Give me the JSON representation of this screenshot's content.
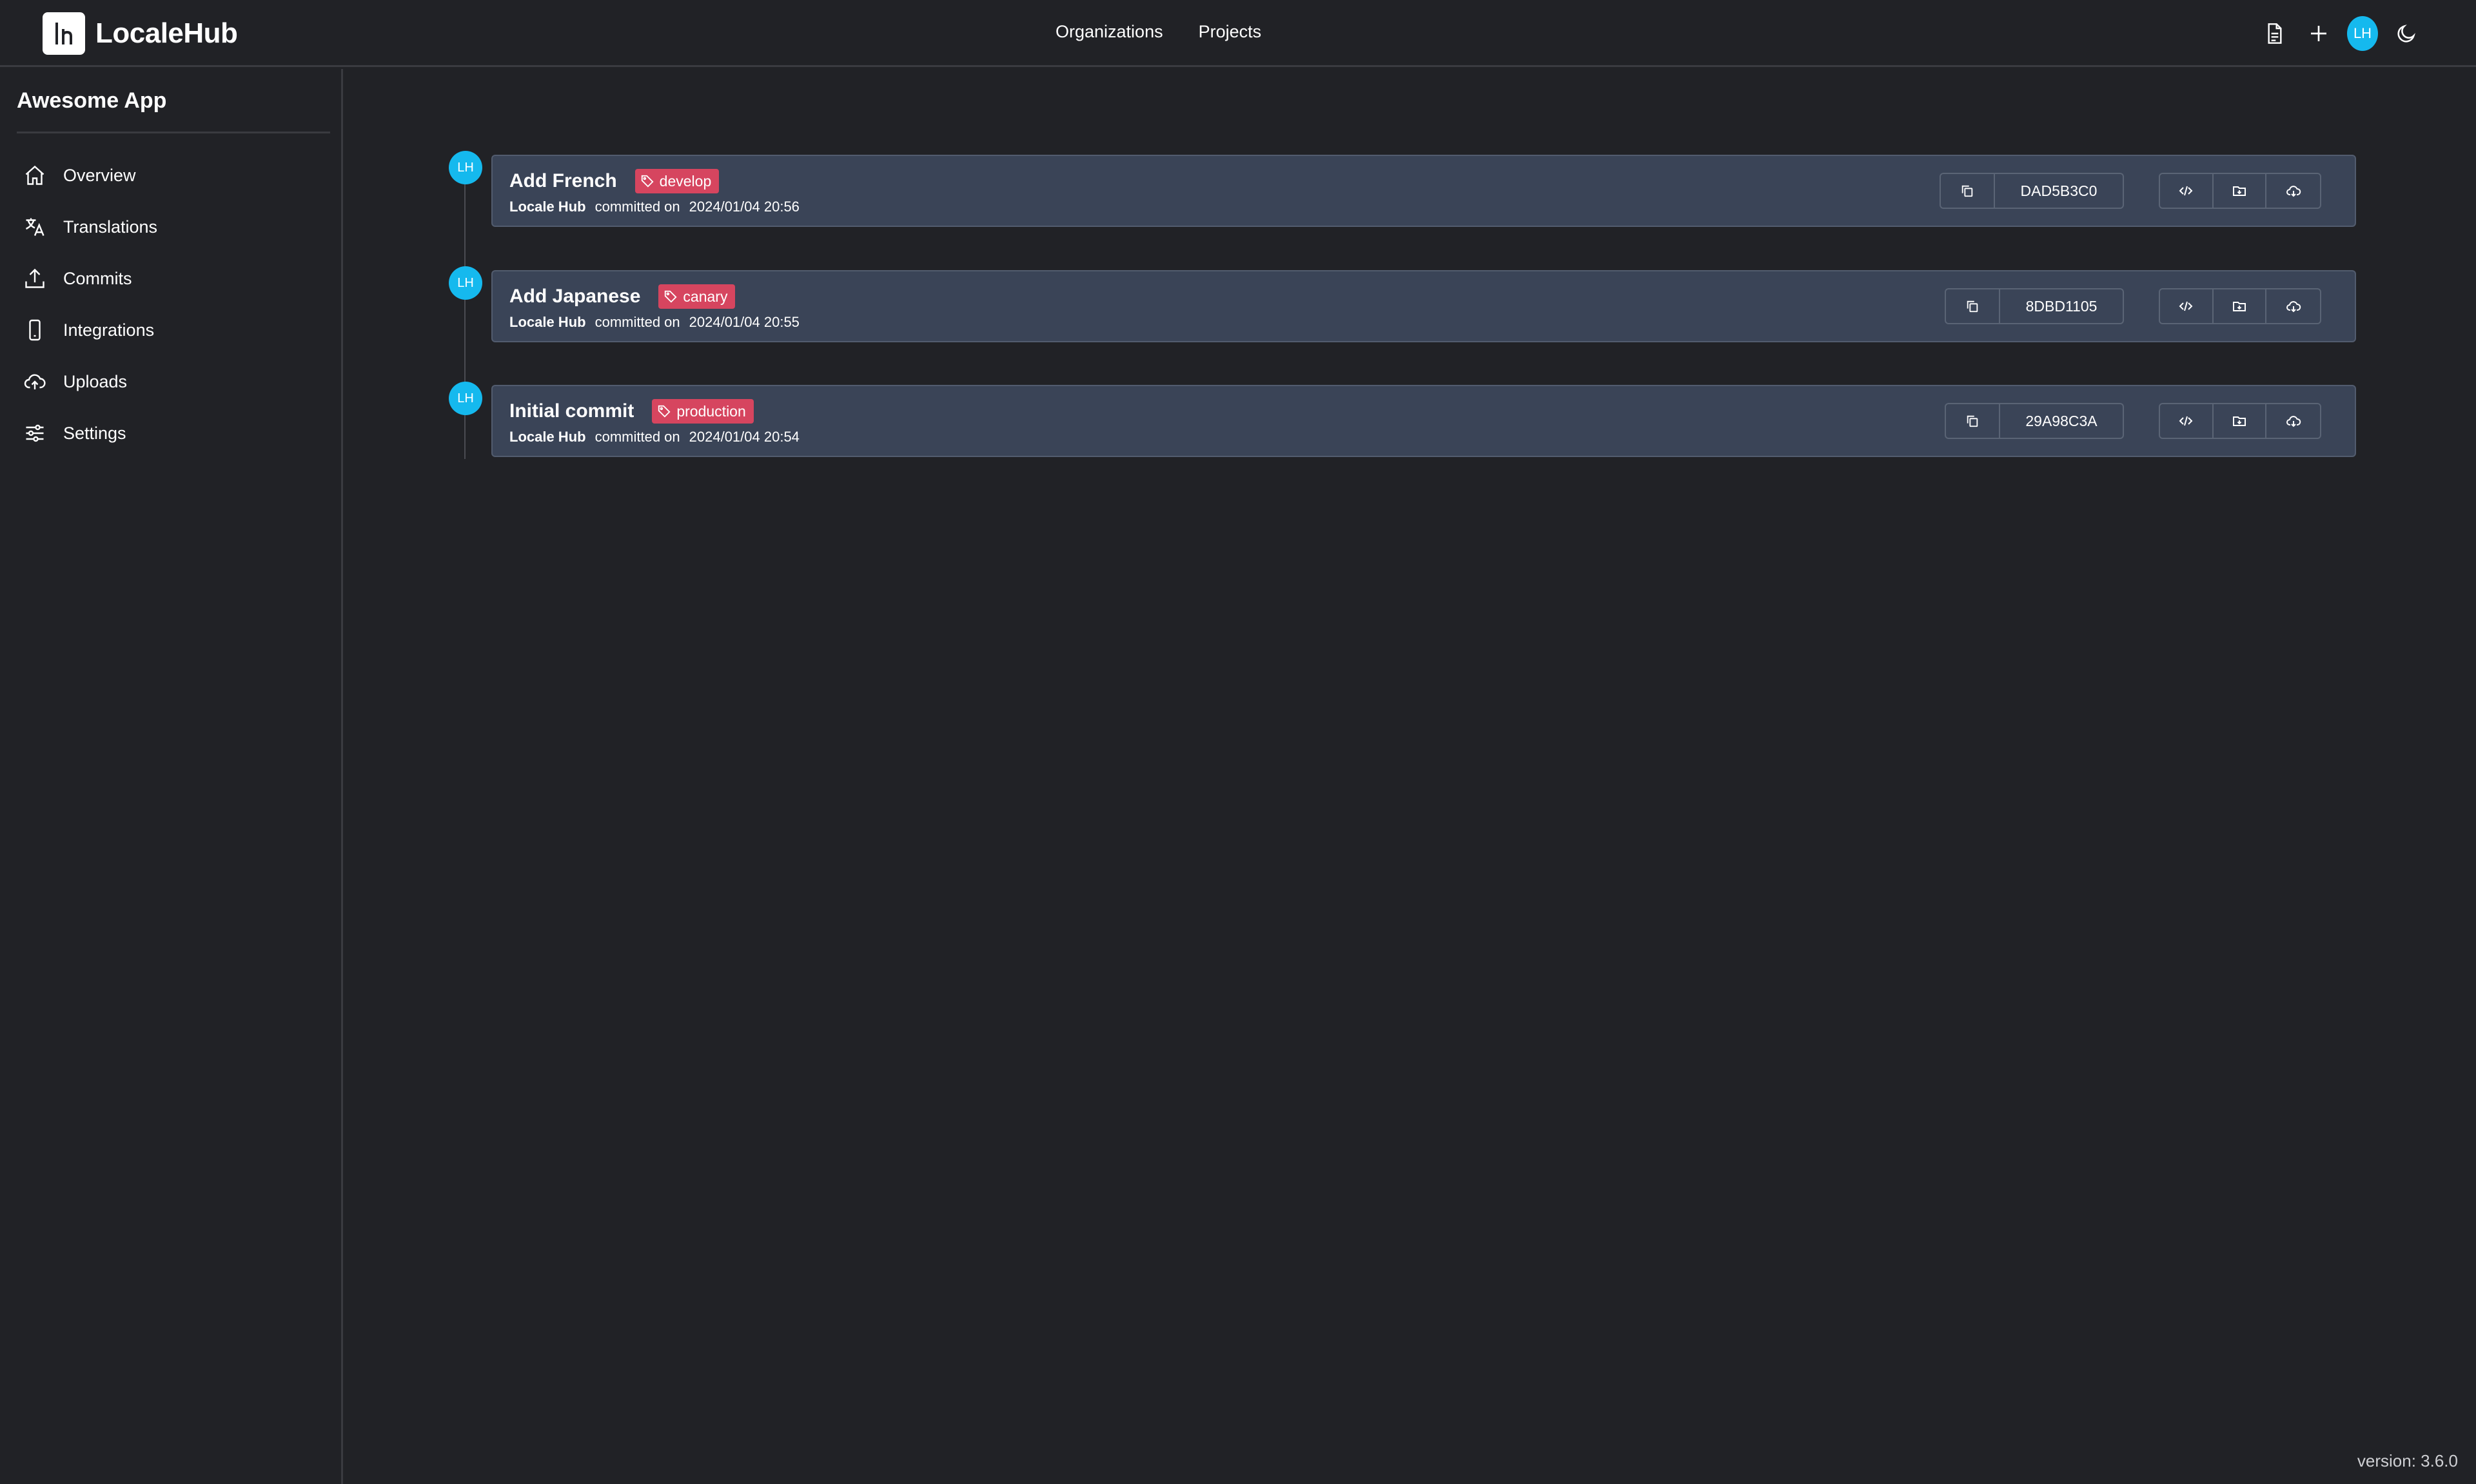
{
  "header": {
    "app_name": "LocaleHub",
    "nav": [
      "Organizations",
      "Projects"
    ],
    "user_initials": "LH",
    "icons": [
      "document-icon",
      "plus-icon",
      "avatar",
      "moon-icon"
    ]
  },
  "sidebar": {
    "project_name": "Awesome App",
    "items": [
      {
        "label": "Overview",
        "icon": "home-icon"
      },
      {
        "label": "Translations",
        "icon": "translate-icon"
      },
      {
        "label": "Commits",
        "icon": "upload-icon"
      },
      {
        "label": "Integrations",
        "icon": "phone-icon"
      },
      {
        "label": "Uploads",
        "icon": "cloud-upload-icon"
      },
      {
        "label": "Settings",
        "icon": "sliders-icon"
      }
    ]
  },
  "commits": [
    {
      "title": "Add French",
      "tag": "develop",
      "author": "Locale Hub",
      "verb": "committed on",
      "date": "2024/01/04 20:56",
      "hash": "DAD5B3C0",
      "avatar": "LH"
    },
    {
      "title": "Add Japanese",
      "tag": "canary",
      "author": "Locale Hub",
      "verb": "committed on",
      "date": "2024/01/04 20:55",
      "hash": "8DBD1105",
      "avatar": "LH"
    },
    {
      "title": "Initial commit",
      "tag": "production",
      "author": "Locale Hub",
      "verb": "committed on",
      "date": "2024/01/04 20:54",
      "hash": "29A98C3A",
      "avatar": "LH"
    }
  ],
  "footer": {
    "version": "version: 3.6.0"
  },
  "colors": {
    "background": "#212226",
    "card": "#3a4457",
    "tag": "#d6455f",
    "avatar": "#15b9ee"
  }
}
